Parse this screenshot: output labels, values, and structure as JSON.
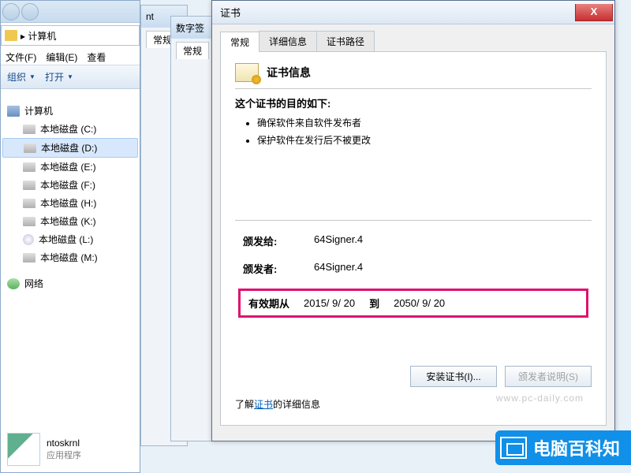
{
  "explorer": {
    "address_path": "计算机",
    "menu": {
      "file": "文件(F)",
      "edit": "编辑(E)",
      "view": "查看"
    },
    "toolbar": {
      "organize": "组织",
      "open": "打开"
    },
    "tree": {
      "computer": "计算机",
      "network": "网络",
      "drives": [
        {
          "label": "本地磁盘 (C:)",
          "icon": "disk"
        },
        {
          "label": "本地磁盘 (D:)",
          "icon": "disk",
          "selected": true
        },
        {
          "label": "本地磁盘 (E:)",
          "icon": "disk"
        },
        {
          "label": "本地磁盘 (F:)",
          "icon": "disk"
        },
        {
          "label": "本地磁盘 (H:)",
          "icon": "disk"
        },
        {
          "label": "本地磁盘 (K:)",
          "icon": "disk"
        },
        {
          "label": "本地磁盘 (L:)",
          "icon": "cd"
        },
        {
          "label": "本地磁盘 (M:)",
          "icon": "disk"
        }
      ]
    },
    "preview": {
      "name": "ntoskrnl",
      "type": "应用程序"
    }
  },
  "back_windows": {
    "w1_title": "nt",
    "w2_title": "数字签",
    "w1_tab": "常规",
    "w2_tab": "常规"
  },
  "cert": {
    "title": "证书",
    "close": "X",
    "tabs": {
      "general": "常规",
      "details": "详细信息",
      "path": "证书路径"
    },
    "info_heading": "证书信息",
    "purpose_heading": "这个证书的目的如下:",
    "purposes": [
      "确保软件来自软件发布者",
      "保护软件在发行后不被更改"
    ],
    "issued_to_label": "颁发给:",
    "issued_to_value": "64Signer.4",
    "issued_by_label": "颁发者:",
    "issued_by_value": "64Signer.4",
    "validity": {
      "from_label": "有效期从",
      "from_value": "2015/ 9/ 20",
      "to_label": "到",
      "to_value": "2050/ 9/ 20"
    },
    "install_btn": "安装证书(I)...",
    "issuer_stmt_btn": "颁发者说明(S)",
    "learn_prefix": "了解",
    "learn_link": "证书",
    "learn_suffix": "的详细信息"
  },
  "watermark": "www.pc-daily.com",
  "banner": "电脑百科知"
}
